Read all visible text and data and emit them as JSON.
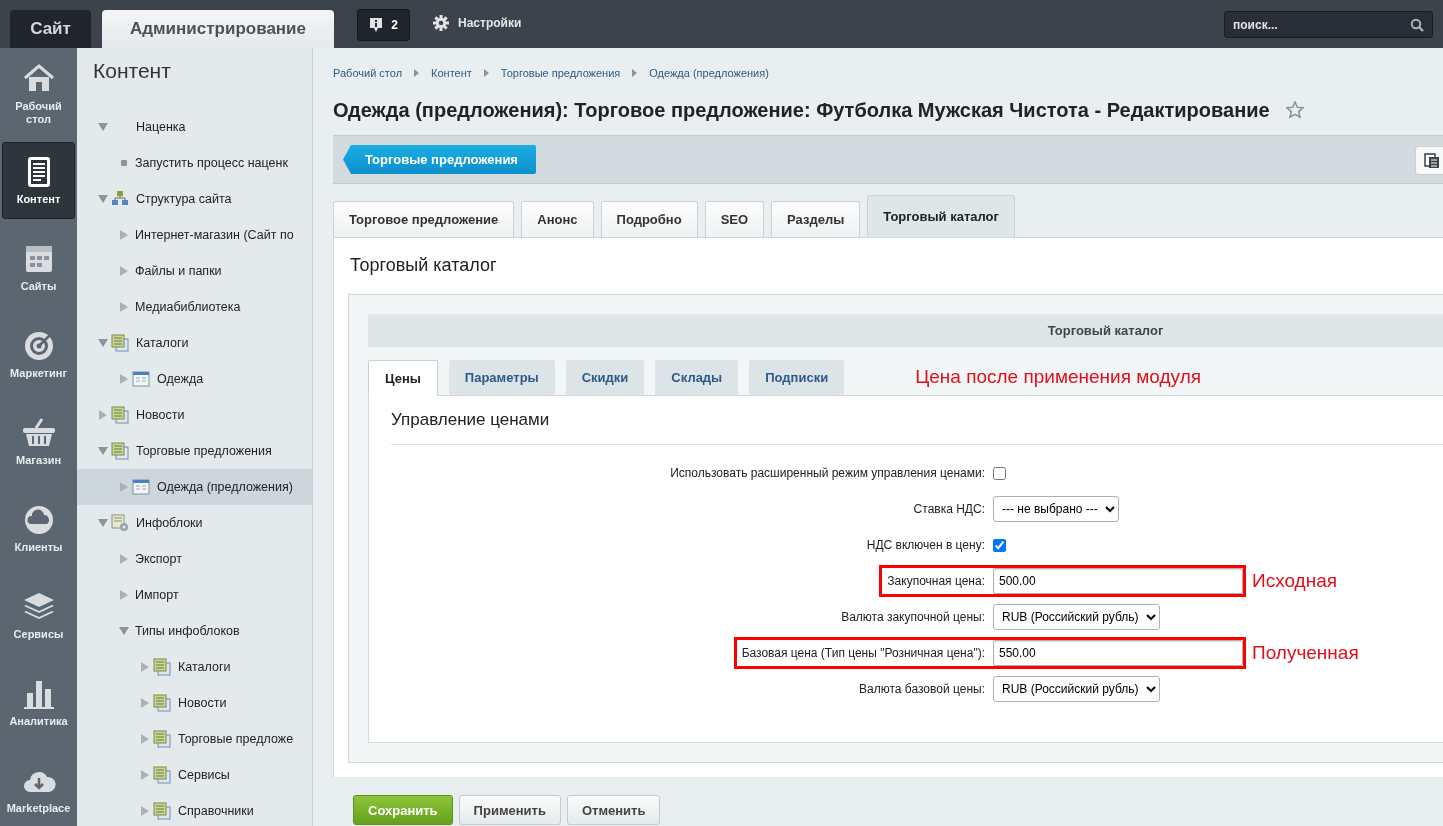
{
  "top_bar": {
    "tabs": [
      {
        "label": "Сайт",
        "selected": false
      },
      {
        "label": "Администрирование",
        "selected": true
      }
    ],
    "notifications": {
      "count": "2"
    },
    "settings": {
      "label": "Настройки"
    },
    "search": {
      "placeholder": "поиск..."
    }
  },
  "menu": [
    {
      "label": "Рабочий стол",
      "selected": false
    },
    {
      "label": "Контент",
      "selected": true
    },
    {
      "label": "Сайты",
      "selected": false
    },
    {
      "label": "Маркетинг",
      "selected": false
    },
    {
      "label": "Магазин",
      "selected": false
    },
    {
      "label": "Клиенты",
      "selected": false
    },
    {
      "label": "Сервисы",
      "selected": false
    },
    {
      "label": "Аналитика",
      "selected": false
    },
    {
      "label": "Marketplace",
      "selected": false
    }
  ],
  "tree": {
    "title": "Контент",
    "items": [
      {
        "label": "Наценка",
        "kind": "plain",
        "expanded": true,
        "selected": false,
        "children": [
          {
            "label": "Запустить процесс наценк",
            "kind": "action",
            "selected": false
          }
        ]
      },
      {
        "label": "Структура сайта",
        "kind": "structure",
        "expanded": true,
        "selected": false,
        "children": [
          {
            "label": "Интернет-магазин (Сайт по",
            "kind": "plain",
            "expanded": false,
            "selected": false
          },
          {
            "label": "Файлы и папки",
            "kind": "plain",
            "expanded": false,
            "selected": false
          },
          {
            "label": "Медиабиблиотека",
            "kind": "plain",
            "expanded": false,
            "selected": false
          }
        ]
      },
      {
        "label": "Каталоги",
        "kind": "type",
        "expanded": true,
        "selected": false,
        "children": [
          {
            "label": "Одежда",
            "kind": "iblock",
            "expanded": false,
            "selected": false
          }
        ]
      },
      {
        "label": "Новости",
        "kind": "type",
        "expanded": false,
        "selected": false
      },
      {
        "label": "Торговые предложения",
        "kind": "type",
        "expanded": true,
        "selected": false,
        "children": [
          {
            "label": "Одежда (предложения)",
            "kind": "iblock",
            "expanded": false,
            "selected": true
          }
        ]
      },
      {
        "label": "Инфоблоки",
        "kind": "settings",
        "expanded": true,
        "selected": false,
        "children": [
          {
            "label": "Экспорт",
            "kind": "plain",
            "expanded": false,
            "selected": false
          },
          {
            "label": "Импорт",
            "kind": "plain",
            "expanded": false,
            "selected": false
          },
          {
            "label": "Типы инфоблоков",
            "kind": "plain",
            "expanded": true,
            "selected": false,
            "children": [
              {
                "label": "Каталоги",
                "kind": "type",
                "expanded": false,
                "selected": false
              },
              {
                "label": "Новости",
                "kind": "type",
                "expanded": false,
                "selected": false
              },
              {
                "label": "Торговые предложе",
                "kind": "type",
                "expanded": false,
                "selected": false
              },
              {
                "label": "Сервисы",
                "kind": "type",
                "expanded": false,
                "selected": false
              },
              {
                "label": "Справочники",
                "kind": "type",
                "expanded": false,
                "selected": false
              }
            ]
          }
        ]
      }
    ]
  },
  "breadcrumbs": [
    "Рабочий стол",
    "Контент",
    "Торговые предложения",
    "Одежда (предложения)"
  ],
  "page_title": "Одежда (предложения): Торговое предложение: Футболка Мужская Чистота - Редактирование",
  "toolbar": {
    "back_button": "Торговые предложения"
  },
  "tabs": [
    {
      "label": "Торговое предложение",
      "selected": false
    },
    {
      "label": "Анонс",
      "selected": false
    },
    {
      "label": "Подробно",
      "selected": false
    },
    {
      "label": "SEO",
      "selected": false
    },
    {
      "label": "Разделы",
      "selected": false
    },
    {
      "label": "Торговый каталог",
      "selected": true
    }
  ],
  "panel": {
    "heading": "Торговый каталог",
    "box_title": "Торговый каталог",
    "subtabs": [
      {
        "label": "Цены",
        "selected": true
      },
      {
        "label": "Параметры",
        "selected": false
      },
      {
        "label": "Скидки",
        "selected": false
      },
      {
        "label": "Склады",
        "selected": false
      },
      {
        "label": "Подписки",
        "selected": false
      }
    ],
    "annotation": "Цена после применения модуля",
    "section": "Управление ценами",
    "fields": [
      {
        "kind": "checkbox",
        "label": "Использовать расширенный режим управления ценами:",
        "checked": false,
        "highlighted": false
      },
      {
        "kind": "select",
        "label": "Ставка НДС:",
        "value": "--- не выбрано ---",
        "highlighted": false
      },
      {
        "kind": "checkbox",
        "label": "НДС включен в цену:",
        "checked": true,
        "highlighted": false
      },
      {
        "kind": "input",
        "label": "Закупочная цена:",
        "value": "500.00",
        "highlighted": true,
        "note": "Исходная"
      },
      {
        "kind": "select",
        "label": "Валюта закупочной цены:",
        "value": "RUB (Российский рубль)",
        "highlighted": false
      },
      {
        "kind": "input",
        "label": "Базовая цена (Тип цены \"Розничная цена\"):",
        "value": "550.00",
        "highlighted": true,
        "note": "Полученная"
      },
      {
        "kind": "select",
        "label": "Валюта базовой цены:",
        "value": "RUB (Российский рубль)",
        "highlighted": false
      }
    ]
  },
  "actions": [
    {
      "label": "Сохранить",
      "kind": "primary"
    },
    {
      "label": "Применить",
      "kind": "default"
    },
    {
      "label": "Отменить",
      "kind": "default"
    }
  ]
}
